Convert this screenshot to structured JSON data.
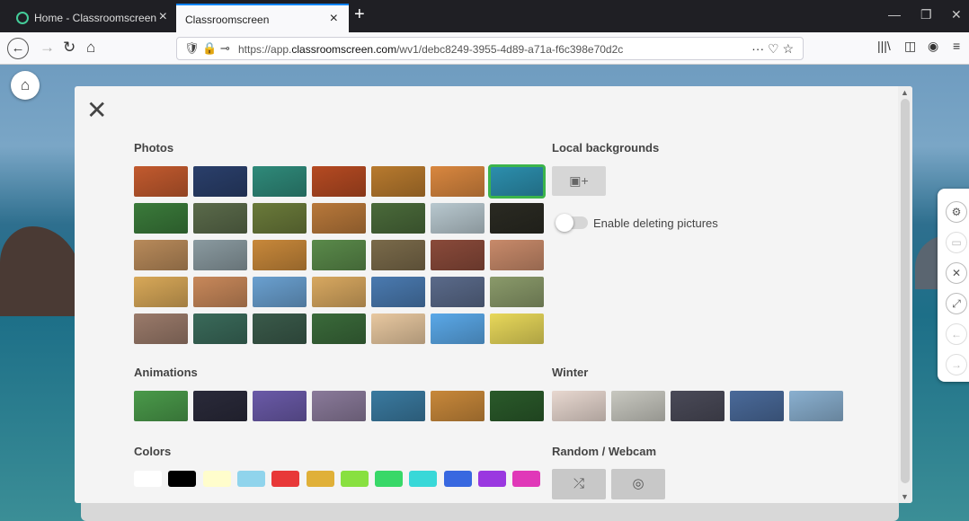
{
  "browser": {
    "tabs": [
      {
        "title": "Home - Classroomscreen"
      },
      {
        "title": "Classroomscreen"
      }
    ],
    "url_prefix": "https://app.",
    "url_domain": "classroomscreen.com",
    "url_path": "/wv1/debc8249-3955-4d89-a71a-f6c398e70d2c"
  },
  "panel": {
    "photos_title": "Photos",
    "local_title": "Local backgrounds",
    "toggle_label": "Enable deleting pictures",
    "animations_title": "Animations",
    "winter_title": "Winter",
    "colors_title": "Colors",
    "random_title": "Random / Webcam"
  },
  "photo_colors": [
    [
      "#c25a2e",
      "#2a3f6b",
      "#2f8a7a",
      "#b54a22",
      "#b87a2e",
      "#d9873f",
      "#2c8fae"
    ],
    [
      "#3a7a3a",
      "#5a6a4a",
      "#6a7a3a",
      "#b8783a",
      "#4a6a3a",
      "#b8c8cf",
      "#2a2a22"
    ],
    [
      "#b88a5a",
      "#8a9aa0",
      "#c8883a",
      "#5a8a4a",
      "#7a6a4a",
      "#8a4a3a",
      "#c88a6a"
    ],
    [
      "#d8a858",
      "#c8885a",
      "#6aa0d0",
      "#d8a860",
      "#4a7ab0",
      "#5a6a8a",
      "#8a9a6a"
    ],
    [
      "#9a7a6a",
      "#3a6a5a",
      "#3a5a4a",
      "#3a6a3a",
      "#e8c8a0",
      "#5aa8e8",
      "#e8d85a"
    ]
  ],
  "animation_colors": [
    "#4a9a4a",
    "#2a2a3a",
    "#6a5aa8",
    "#8a7a9a",
    "#3a7aa0",
    "#c8883a",
    "#2a5a2a"
  ],
  "winter_colors": [
    "#e8d8d0",
    "#c8c8c0",
    "#4a4a58",
    "#4a6a9a",
    "#8ab0d0"
  ],
  "swatch_colors": [
    "#ffffff",
    "#000000",
    "#fffdcc",
    "#90d4ec",
    "#e83838",
    "#e0b038",
    "#88e040",
    "#38d868",
    "#38d8d8",
    "#3868e0",
    "#9a38e0",
    "#e038b8"
  ]
}
